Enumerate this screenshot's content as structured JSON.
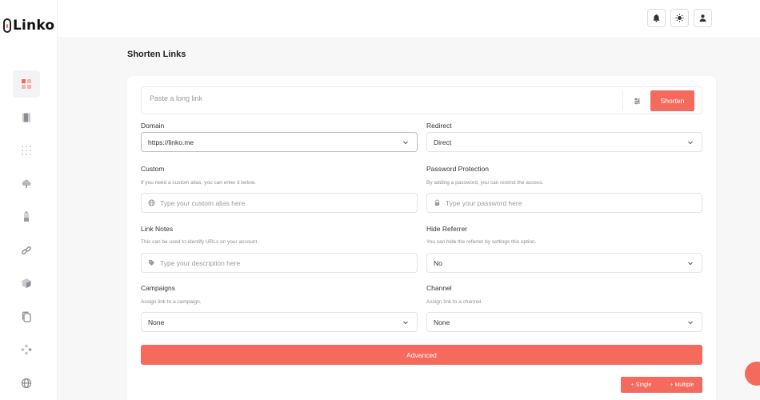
{
  "app": {
    "name": "Linko"
  },
  "sidebar": {
    "items": [
      {
        "icon": "dashboard-icon"
      },
      {
        "icon": "book-icon"
      },
      {
        "icon": "dots-grid-icon"
      },
      {
        "icon": "cloud-icon"
      },
      {
        "icon": "battery-icon"
      },
      {
        "icon": "link-icon"
      },
      {
        "icon": "cube-icon"
      },
      {
        "icon": "copy-icon"
      },
      {
        "icon": "diamonds-icon"
      },
      {
        "icon": "globe-icon"
      }
    ]
  },
  "topbar": {
    "icons": [
      "bell-icon",
      "sun-icon",
      "user-icon"
    ]
  },
  "page": {
    "title": "Shorten Links"
  },
  "shorten": {
    "placeholder": "Paste a long link",
    "button": "Shorten"
  },
  "form": {
    "domain": {
      "label": "Domain",
      "value": "https://linko.me"
    },
    "redirect": {
      "label": "Redirect",
      "value": "Direct"
    },
    "custom": {
      "label": "Custom",
      "help": "If you need a custom alias, you can enter it below.",
      "placeholder": "Type your custom alias here"
    },
    "password": {
      "label": "Password Protection",
      "help": "By adding a password, you can restrict the access.",
      "placeholder": "Type your password here"
    },
    "notes": {
      "label": "Link Notes",
      "help": "This can be used to identify URLs on your account.",
      "placeholder": "Type your description here"
    },
    "hide_referrer": {
      "label": "Hide Referrer",
      "help": "You can hide the referrer by settings this option.",
      "value": "No"
    },
    "campaigns": {
      "label": "Campaigns",
      "help": "Assign link to a campaign.",
      "value": "None"
    },
    "channel": {
      "label": "Channel",
      "help": "Assign link to a channel.",
      "value": "None"
    }
  },
  "actions": {
    "advanced": "Advanced",
    "single": "+ Single",
    "multiple": "+ Multiple"
  },
  "colors": {
    "accent": "#f46a5c",
    "background": "#f7f7f8"
  }
}
